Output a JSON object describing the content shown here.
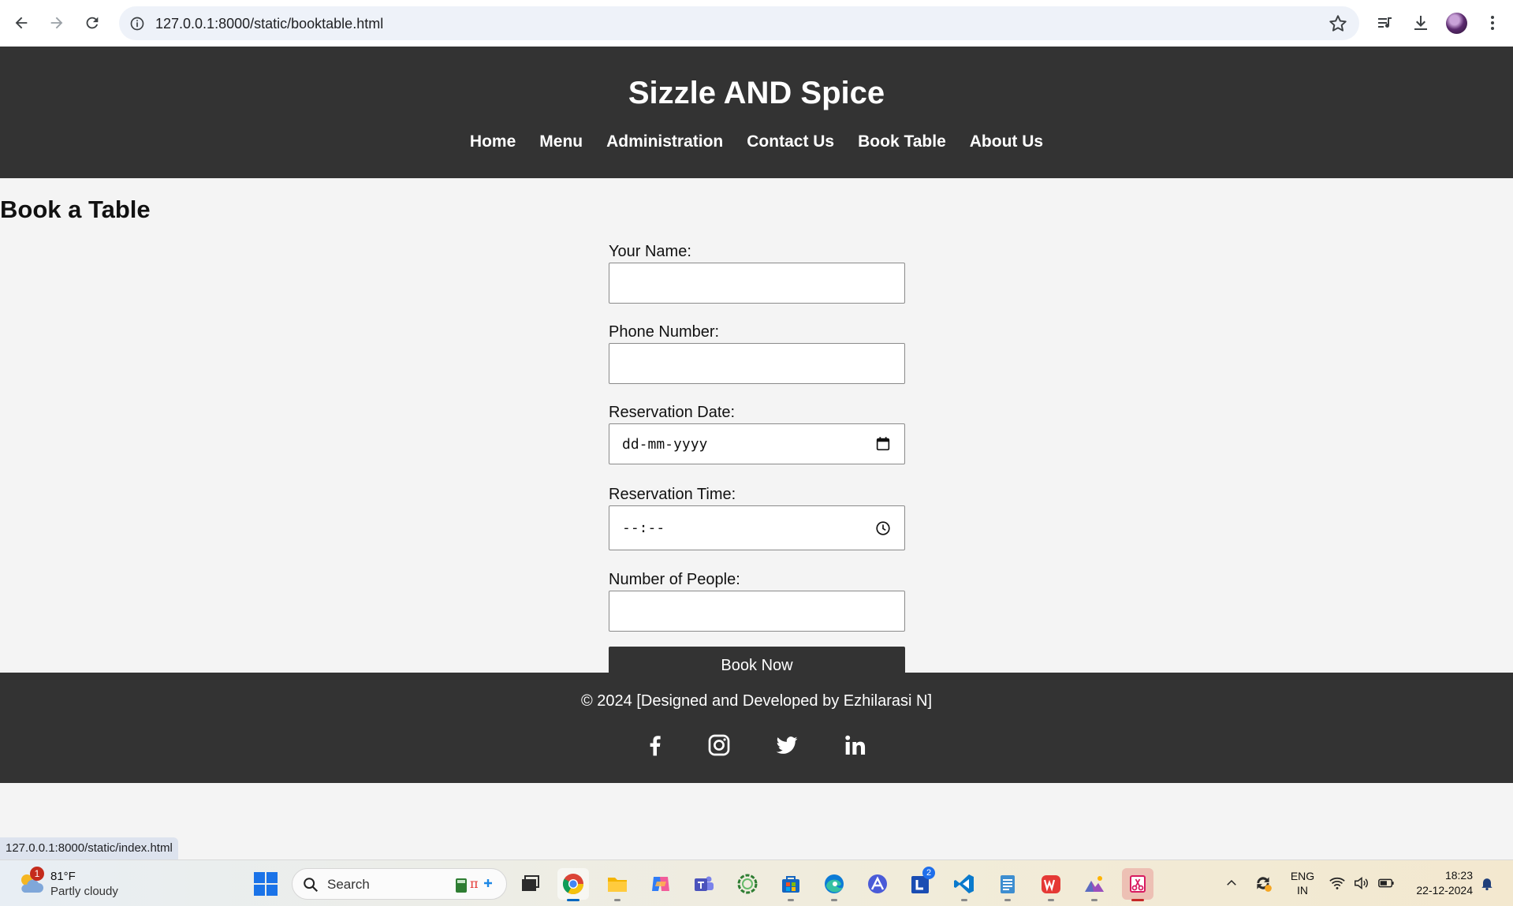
{
  "browser": {
    "url": "127.0.0.1:8000/static/booktable.html",
    "status_url": "127.0.0.1:8000/static/index.html"
  },
  "site": {
    "title": "Sizzle AND Spice",
    "nav": [
      "Home",
      "Menu",
      "Administration",
      "Contact Us",
      "Book Table",
      "About Us"
    ]
  },
  "page": {
    "heading": "Book a Table",
    "form": {
      "name_label": "Your Name:",
      "phone_label": "Phone Number:",
      "date_label": "Reservation Date:",
      "date_placeholder": "dd-mm-yyyy",
      "time_label": "Reservation Time:",
      "time_placeholder": "--:--",
      "people_label": "Number of People:",
      "submit_label": "Book Now"
    }
  },
  "footer": {
    "copyright": "© 2024 [Designed and Developed by Ezhilarasi N]",
    "socials": [
      "facebook-icon",
      "instagram-icon",
      "twitter-icon",
      "linkedin-icon"
    ]
  },
  "taskbar": {
    "weather_badge": "1",
    "temperature": "81°F",
    "condition": "Partly cloudy",
    "search_label": "Search",
    "lang_top": "ENG",
    "lang_bottom": "IN",
    "time": "18:23",
    "date": "22-12-2024",
    "apps": [
      "task-view",
      "chrome",
      "file-explorer",
      "copilot",
      "teams",
      "circle-app",
      "store",
      "edge",
      "arc-app",
      "libby-app",
      "vscode",
      "notepad",
      "wps-office",
      "photos-app",
      "snipping-tool"
    ],
    "libby_badge": "2"
  },
  "colors": {
    "header_bg": "#333333",
    "page_bg": "#f4f4f4",
    "button_bg": "#333333"
  }
}
